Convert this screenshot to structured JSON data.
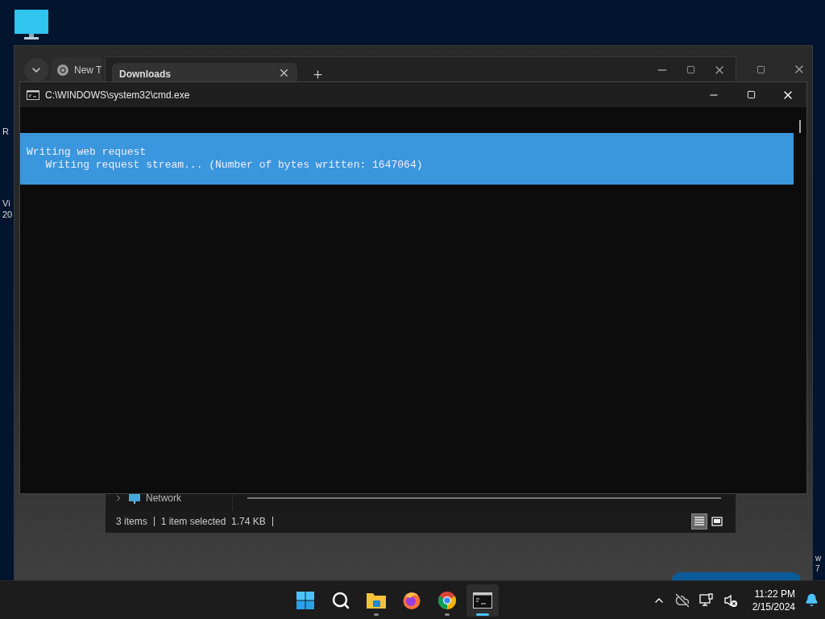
{
  "desktop": {
    "left_labels": [
      "R",
      "Vi",
      "20"
    ],
    "right_labels": [
      "w",
      "7"
    ]
  },
  "browser_window": {
    "tabs": [
      {
        "title": "New T",
        "selected": false
      }
    ]
  },
  "explorer_window": {
    "tabs": [
      {
        "title": "Downloads",
        "selected": true
      }
    ],
    "nav_items": [
      {
        "label": "Network",
        "expanded": false
      }
    ],
    "status_bar": [
      "3 items",
      "1 item selected  1.74 KB"
    ],
    "view_buttons": [
      {
        "kind": "details",
        "selected": true
      },
      {
        "kind": "large-icons",
        "selected": false
      }
    ]
  },
  "console_window": {
    "title": "C:\\WINDOWS\\system32\\cmd.exe",
    "lines": [
      "Writing web request",
      "   Writing request stream... (Number of bytes written: 1647064)"
    ]
  },
  "taskbar": {
    "apps": [
      {
        "kind": "start",
        "running": false,
        "selected": false
      },
      {
        "kind": "search",
        "running": false,
        "selected": false
      },
      {
        "kind": "files",
        "running": true,
        "selected": false
      },
      {
        "kind": "firefox",
        "running": false,
        "selected": false
      },
      {
        "kind": "chrome",
        "running": true,
        "selected": false
      },
      {
        "kind": "terminal",
        "running": true,
        "selected": true
      }
    ],
    "time": "11:22 PM",
    "date": "2/15/2024"
  }
}
